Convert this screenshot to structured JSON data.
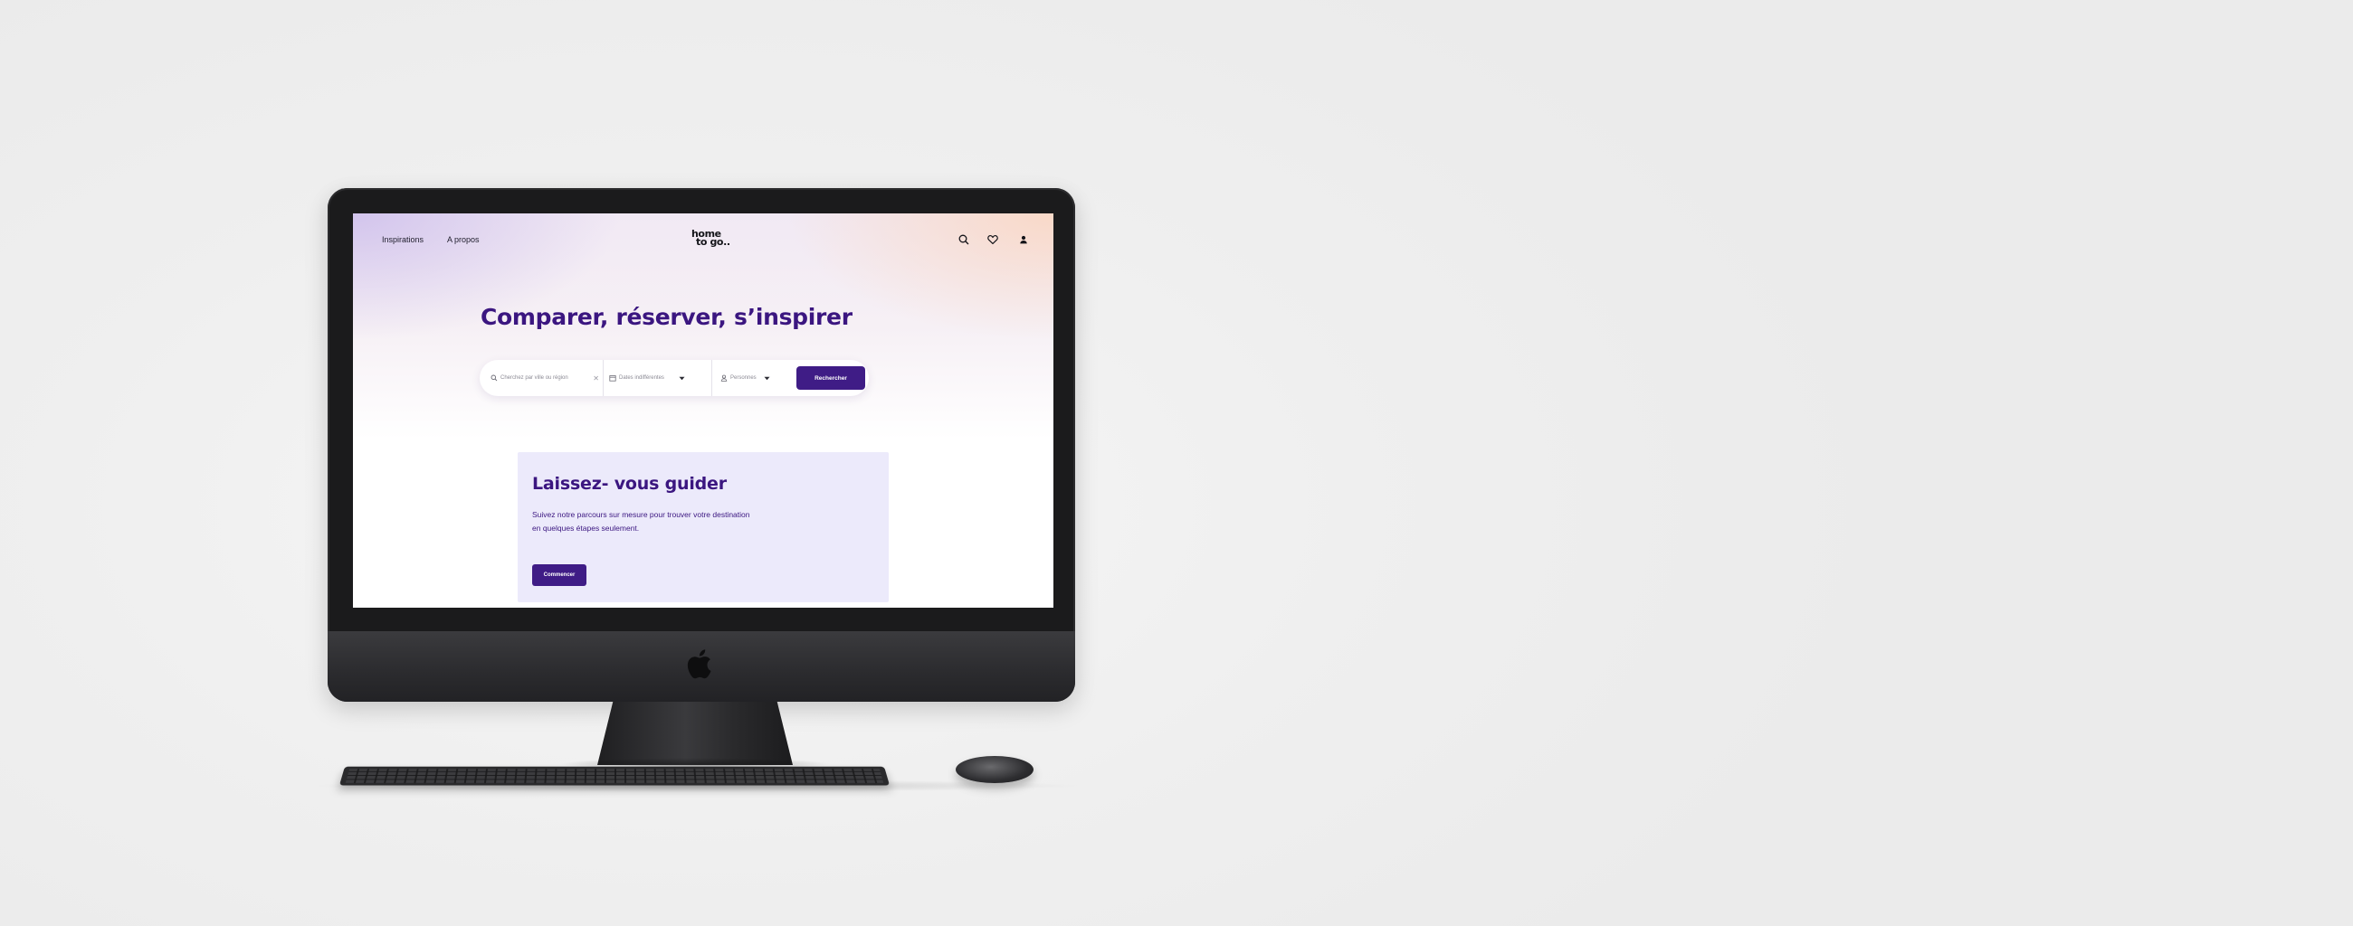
{
  "nav": {
    "links": [
      "Inspirations",
      "A propos"
    ],
    "logo_line1": "home",
    "logo_line2": "to go..",
    "icons": [
      "search-icon",
      "heart-icon",
      "user-icon"
    ]
  },
  "hero": {
    "title": "Comparer, réserver, s’inspirer"
  },
  "search": {
    "destination_placeholder": "Cherchez par ville ou région",
    "dates_placeholder": "Dates indifférentes",
    "guests_placeholder": "Personnes",
    "button_label": "Rechercher"
  },
  "guide": {
    "title": "Laissez- vous guider",
    "text_line1": "Suivez notre parcours sur mesure pour trouver votre destination",
    "text_line2": "en quelques étapes seulement.",
    "button_label": "Commencer"
  },
  "colors": {
    "brand_purple": "#3f1c86",
    "title_purple": "#3b1680",
    "card_background": "#eceafb",
    "page_background": "#efefef"
  }
}
